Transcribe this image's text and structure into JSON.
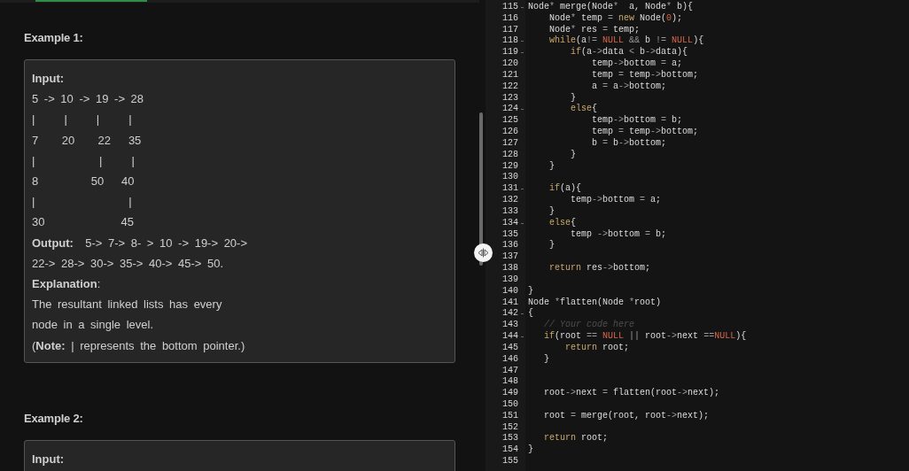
{
  "problem": {
    "examples": [
      {
        "title": "Example 1:",
        "lines": [
          {
            "kind": "label",
            "text": "Input:"
          },
          {
            "kind": "text",
            "text": "5 -> 10 -> 19 -> 28"
          },
          {
            "kind": "text",
            "text": "|     |     |     |"
          },
          {
            "kind": "text",
            "text": "7    20    22   35"
          },
          {
            "kind": "text",
            "text": "|           |     |"
          },
          {
            "kind": "text",
            "text": "8         50   40"
          },
          {
            "kind": "text",
            "text": "|                |"
          },
          {
            "kind": "text",
            "text": "30             45"
          },
          {
            "kind": "text",
            "text": "**Output:**  5-> 7-> 8- > 10 -> 19-> 20->"
          },
          {
            "kind": "text",
            "text": "22-> 28-> 30-> 35-> 40-> 45-> 50."
          },
          {
            "kind": "text",
            "text": "**Explanation**:"
          },
          {
            "kind": "text",
            "text": "The resultant linked lists has every"
          },
          {
            "kind": "text",
            "text": "node in a single level."
          },
          {
            "kind": "text",
            "text": "(**Note:** | represents the bottom pointer.)"
          }
        ]
      },
      {
        "title": "Example 2:",
        "lines": [
          {
            "kind": "label",
            "text": "Input:"
          }
        ]
      }
    ]
  },
  "editor": {
    "lines": [
      {
        "number": "115",
        "fold": true,
        "tokens": [
          {
            "kind": "plain",
            "text": "Node"
          },
          {
            "kind": "op",
            "text": "*"
          },
          {
            "kind": "plain",
            "text": " merge(Node"
          },
          {
            "kind": "op",
            "text": "*"
          },
          {
            "kind": "plain",
            "text": "  a, Node"
          },
          {
            "kind": "op",
            "text": "*"
          },
          {
            "kind": "plain",
            "text": " b){"
          }
        ]
      },
      {
        "number": "116",
        "fold": false,
        "tokens": [
          {
            "kind": "plain",
            "text": "    Node"
          },
          {
            "kind": "op",
            "text": "*"
          },
          {
            "kind": "plain",
            "text": " temp "
          },
          {
            "kind": "op",
            "text": "= "
          },
          {
            "kind": "keyword",
            "text": "new"
          },
          {
            "kind": "plain",
            "text": " Node("
          },
          {
            "kind": "literal",
            "text": "0"
          },
          {
            "kind": "plain",
            "text": ");"
          }
        ]
      },
      {
        "number": "117",
        "fold": false,
        "tokens": [
          {
            "kind": "plain",
            "text": "    Node"
          },
          {
            "kind": "op",
            "text": "*"
          },
          {
            "kind": "plain",
            "text": " res "
          },
          {
            "kind": "op",
            "text": "="
          },
          {
            "kind": "plain",
            "text": " temp;"
          }
        ]
      },
      {
        "number": "118",
        "fold": true,
        "tokens": [
          {
            "kind": "keyword",
            "text": "    while"
          },
          {
            "kind": "plain",
            "text": "(a"
          },
          {
            "kind": "op",
            "text": "!= "
          },
          {
            "kind": "literal",
            "text": "NULL"
          },
          {
            "kind": "op",
            "text": " &&"
          },
          {
            "kind": "plain",
            "text": " b "
          },
          {
            "kind": "op",
            "text": "!= "
          },
          {
            "kind": "literal",
            "text": "NULL"
          },
          {
            "kind": "plain",
            "text": "){"
          }
        ]
      },
      {
        "number": "119",
        "fold": true,
        "tokens": [
          {
            "kind": "keyword",
            "text": "        if"
          },
          {
            "kind": "plain",
            "text": "(a"
          },
          {
            "kind": "op",
            "text": "->"
          },
          {
            "kind": "plain",
            "text": "data "
          },
          {
            "kind": "op",
            "text": "<"
          },
          {
            "kind": "plain",
            "text": " b"
          },
          {
            "kind": "op",
            "text": "->"
          },
          {
            "kind": "plain",
            "text": "data){"
          }
        ]
      },
      {
        "number": "120",
        "fold": false,
        "tokens": [
          {
            "kind": "plain",
            "text": "            temp"
          },
          {
            "kind": "op",
            "text": "->"
          },
          {
            "kind": "plain",
            "text": "bottom "
          },
          {
            "kind": "op",
            "text": "="
          },
          {
            "kind": "plain",
            "text": " a;"
          }
        ]
      },
      {
        "number": "121",
        "fold": false,
        "tokens": [
          {
            "kind": "plain",
            "text": "            temp "
          },
          {
            "kind": "op",
            "text": "="
          },
          {
            "kind": "plain",
            "text": " temp"
          },
          {
            "kind": "op",
            "text": "->"
          },
          {
            "kind": "plain",
            "text": "bottom;"
          }
        ]
      },
      {
        "number": "122",
        "fold": false,
        "tokens": [
          {
            "kind": "plain",
            "text": "            a "
          },
          {
            "kind": "op",
            "text": "="
          },
          {
            "kind": "plain",
            "text": " a"
          },
          {
            "kind": "op",
            "text": "->"
          },
          {
            "kind": "plain",
            "text": "bottom;"
          }
        ]
      },
      {
        "number": "123",
        "fold": false,
        "tokens": [
          {
            "kind": "plain",
            "text": "        }"
          }
        ]
      },
      {
        "number": "124",
        "fold": true,
        "tokens": [
          {
            "kind": "keyword",
            "text": "        else"
          },
          {
            "kind": "plain",
            "text": "{"
          }
        ]
      },
      {
        "number": "125",
        "fold": false,
        "tokens": [
          {
            "kind": "plain",
            "text": "            temp"
          },
          {
            "kind": "op",
            "text": "->"
          },
          {
            "kind": "plain",
            "text": "bottom "
          },
          {
            "kind": "op",
            "text": "="
          },
          {
            "kind": "plain",
            "text": " b;"
          }
        ]
      },
      {
        "number": "126",
        "fold": false,
        "tokens": [
          {
            "kind": "plain",
            "text": "            temp "
          },
          {
            "kind": "op",
            "text": "="
          },
          {
            "kind": "plain",
            "text": " temp"
          },
          {
            "kind": "op",
            "text": "->"
          },
          {
            "kind": "plain",
            "text": "bottom;"
          }
        ]
      },
      {
        "number": "127",
        "fold": false,
        "tokens": [
          {
            "kind": "plain",
            "text": "            b "
          },
          {
            "kind": "op",
            "text": "="
          },
          {
            "kind": "plain",
            "text": " b"
          },
          {
            "kind": "op",
            "text": "->"
          },
          {
            "kind": "plain",
            "text": "bottom;"
          }
        ]
      },
      {
        "number": "128",
        "fold": false,
        "tokens": [
          {
            "kind": "plain",
            "text": "        }"
          }
        ]
      },
      {
        "number": "129",
        "fold": false,
        "tokens": [
          {
            "kind": "plain",
            "text": "    }"
          }
        ]
      },
      {
        "number": "130",
        "fold": false
      },
      {
        "number": "131",
        "fold": true,
        "tokens": [
          {
            "kind": "keyword",
            "text": "    if"
          },
          {
            "kind": "plain",
            "text": "(a){"
          }
        ]
      },
      {
        "number": "132",
        "fold": false,
        "tokens": [
          {
            "kind": "plain",
            "text": "        temp"
          },
          {
            "kind": "op",
            "text": "->"
          },
          {
            "kind": "plain",
            "text": "bottom "
          },
          {
            "kind": "op",
            "text": "="
          },
          {
            "kind": "plain",
            "text": " a;"
          }
        ]
      },
      {
        "number": "133",
        "fold": false,
        "tokens": [
          {
            "kind": "plain",
            "text": "    }"
          }
        ]
      },
      {
        "number": "134",
        "fold": true,
        "tokens": [
          {
            "kind": "keyword",
            "text": "    else"
          },
          {
            "kind": "plain",
            "text": "{"
          }
        ]
      },
      {
        "number": "135",
        "fold": false,
        "tokens": [
          {
            "kind": "plain",
            "text": "        temp "
          },
          {
            "kind": "op",
            "text": "->"
          },
          {
            "kind": "plain",
            "text": "bottom "
          },
          {
            "kind": "op",
            "text": "="
          },
          {
            "kind": "plain",
            "text": " b;"
          }
        ]
      },
      {
        "number": "136",
        "fold": false,
        "tokens": [
          {
            "kind": "plain",
            "text": "    }"
          }
        ]
      },
      {
        "number": "137",
        "fold": false
      },
      {
        "number": "138",
        "fold": false,
        "tokens": [
          {
            "kind": "keyword",
            "text": "    return"
          },
          {
            "kind": "plain",
            "text": " res"
          },
          {
            "kind": "op",
            "text": "->"
          },
          {
            "kind": "plain",
            "text": "bottom;"
          }
        ]
      },
      {
        "number": "139",
        "fold": false
      },
      {
        "number": "140",
        "fold": false,
        "tokens": [
          {
            "kind": "plain",
            "text": "}"
          }
        ]
      },
      {
        "number": "141",
        "fold": false,
        "tokens": [
          {
            "kind": "plain",
            "text": "Node "
          },
          {
            "kind": "op",
            "text": "*"
          },
          {
            "kind": "plain",
            "text": "flatten(Node "
          },
          {
            "kind": "op",
            "text": "*"
          },
          {
            "kind": "plain",
            "text": "root)"
          }
        ]
      },
      {
        "number": "142",
        "fold": true,
        "tokens": [
          {
            "kind": "plain",
            "text": "{"
          }
        ]
      },
      {
        "number": "143",
        "fold": false,
        "tokens": [
          {
            "kind": "comment",
            "text": "   // Your code here"
          }
        ]
      },
      {
        "number": "144",
        "fold": true,
        "tokens": [
          {
            "kind": "keyword",
            "text": "   if"
          },
          {
            "kind": "plain",
            "text": "(root "
          },
          {
            "kind": "op",
            "text": "== "
          },
          {
            "kind": "literal",
            "text": "NULL"
          },
          {
            "kind": "op",
            "text": " ||"
          },
          {
            "kind": "plain",
            "text": " root"
          },
          {
            "kind": "op",
            "text": "->"
          },
          {
            "kind": "plain",
            "text": "next "
          },
          {
            "kind": "op",
            "text": "=="
          },
          {
            "kind": "literal",
            "text": "NULL"
          },
          {
            "kind": "plain",
            "text": "){"
          }
        ]
      },
      {
        "number": "145",
        "fold": false,
        "tokens": [
          {
            "kind": "keyword",
            "text": "       return"
          },
          {
            "kind": "plain",
            "text": " root;"
          }
        ]
      },
      {
        "number": "146",
        "fold": false,
        "tokens": [
          {
            "kind": "plain",
            "text": "   }"
          }
        ]
      },
      {
        "number": "147",
        "fold": false
      },
      {
        "number": "148",
        "fold": false
      },
      {
        "number": "149",
        "fold": false,
        "tokens": [
          {
            "kind": "plain",
            "text": "   root"
          },
          {
            "kind": "op",
            "text": "->"
          },
          {
            "kind": "plain",
            "text": "next "
          },
          {
            "kind": "op",
            "text": "="
          },
          {
            "kind": "plain",
            "text": " flatten(root"
          },
          {
            "kind": "op",
            "text": "->"
          },
          {
            "kind": "plain",
            "text": "next);"
          }
        ]
      },
      {
        "number": "150",
        "fold": false
      },
      {
        "number": "151",
        "fold": false,
        "tokens": [
          {
            "kind": "plain",
            "text": "   root "
          },
          {
            "kind": "op",
            "text": "="
          },
          {
            "kind": "plain",
            "text": " merge(root, root"
          },
          {
            "kind": "op",
            "text": "->"
          },
          {
            "kind": "plain",
            "text": "next);"
          }
        ]
      },
      {
        "number": "152",
        "fold": false
      },
      {
        "number": "153",
        "fold": false,
        "tokens": [
          {
            "kind": "keyword",
            "text": "   return"
          },
          {
            "kind": "plain",
            "text": " root;"
          }
        ]
      },
      {
        "number": "154",
        "fold": false,
        "tokens": [
          {
            "kind": "plain",
            "text": "}"
          }
        ]
      },
      {
        "number": "155",
        "fold": false
      }
    ]
  }
}
